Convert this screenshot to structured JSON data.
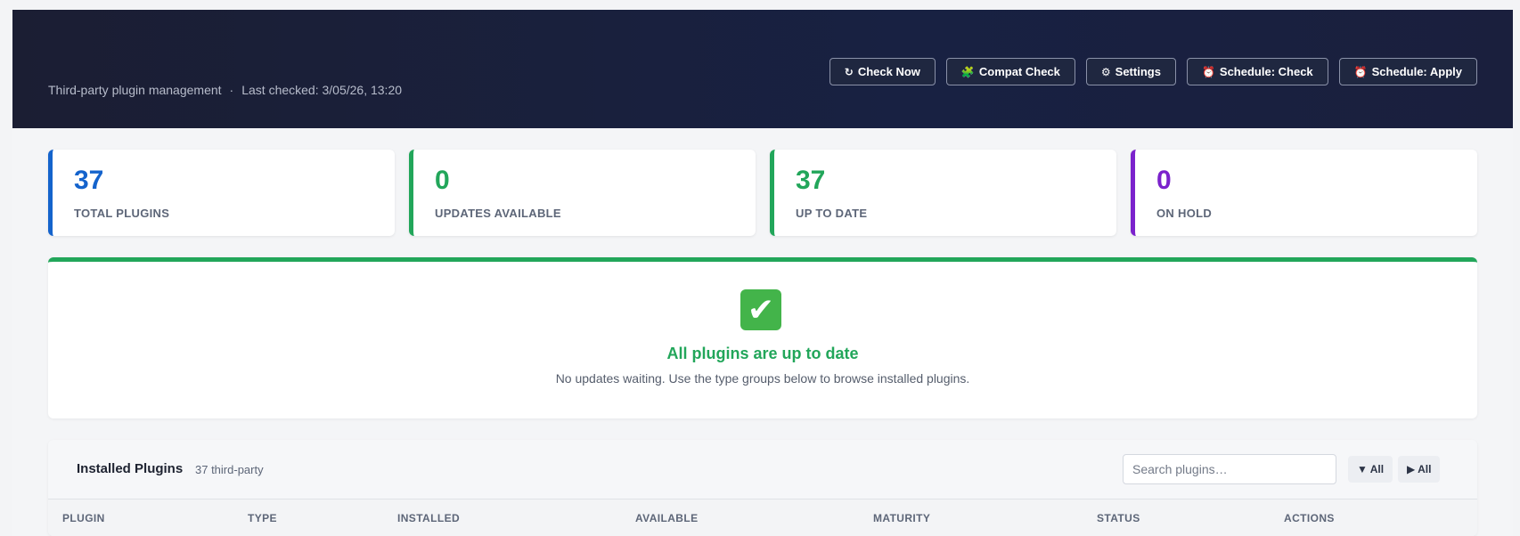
{
  "header": {
    "title": "",
    "subtitle": "Third-party plugin management",
    "separator": "·",
    "last_checked": "Last checked: 3/05/26, 13:20",
    "buttons": [
      {
        "icon": "↻",
        "icon_name": "refresh-icon",
        "label": "Check Now"
      },
      {
        "icon": "🧩",
        "icon_name": "puzzle-icon",
        "label": "Compat Check"
      },
      {
        "icon": "⚙",
        "icon_name": "gear-icon",
        "label": "Settings"
      },
      {
        "icon": "⏰",
        "icon_name": "alarm-clock-icon",
        "label": "Schedule: Check"
      },
      {
        "icon": "⏰",
        "icon_name": "alarm-clock-icon",
        "label": "Schedule: Apply"
      }
    ]
  },
  "stats": [
    {
      "value": "37",
      "label": "TOTAL PLUGINS",
      "color": "#1463cc"
    },
    {
      "value": "0",
      "label": "UPDATES AVAILABLE",
      "color": "#22a65a"
    },
    {
      "value": "37",
      "label": "UP TO DATE",
      "color": "#22a65a"
    },
    {
      "value": "0",
      "label": "ON HOLD",
      "color": "#7b22cc"
    }
  ],
  "banner": {
    "icon": "✔",
    "icon_name": "check-mark-icon",
    "title": "All plugins are up to date",
    "text": "No updates waiting. Use the type groups below to browse installed plugins."
  },
  "panel": {
    "title": "Installed Plugins",
    "count": "37 third-party",
    "search_placeholder": "Search plugins…",
    "collapse_label": "▼ All",
    "expand_label": "▶ All",
    "columns": [
      "PLUGIN",
      "TYPE",
      "INSTALLED",
      "AVAILABLE",
      "MATURITY",
      "STATUS",
      "ACTIONS"
    ]
  },
  "colors": {
    "header_bg": "#1b1e33",
    "success": "#22a65a",
    "primary": "#1463cc",
    "hold": "#7b22cc"
  }
}
